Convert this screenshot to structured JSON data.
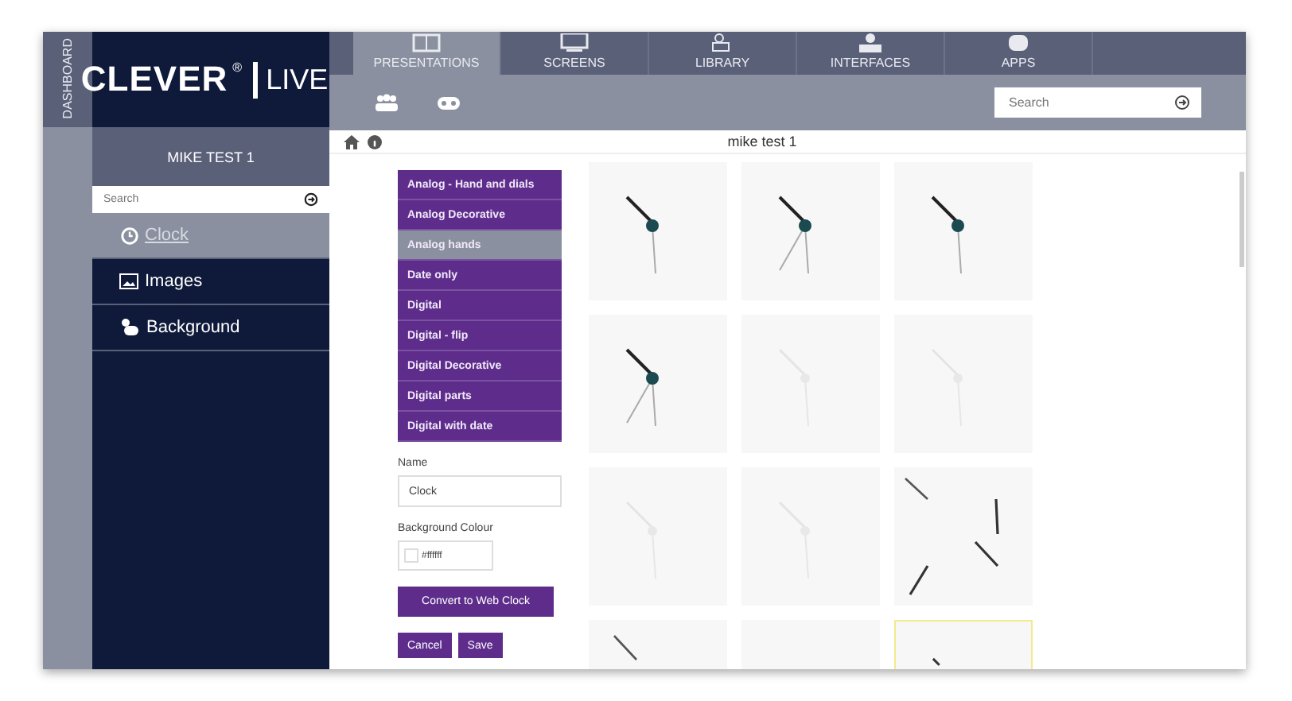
{
  "dashboard_label": "DASHBOARD",
  "logo": {
    "text": "CLEVER",
    "mark": "®",
    "badge": "LIVE"
  },
  "sidebar": {
    "title": "MIKE TEST 1",
    "search": {
      "placeholder": "Search"
    },
    "items": [
      {
        "label": "Clock",
        "selected": true
      },
      {
        "label": "Images",
        "selected": false
      },
      {
        "label": "Background",
        "selected": false
      }
    ]
  },
  "tabs": [
    {
      "label": "PRESENTATIONS",
      "selected": true
    },
    {
      "label": "SCREENS",
      "selected": false
    },
    {
      "label": "LIBRARY",
      "selected": false
    },
    {
      "label": "INTERFACES",
      "selected": false
    },
    {
      "label": "APPS",
      "selected": false
    }
  ],
  "toolbar": {
    "search": {
      "placeholder": "Search"
    }
  },
  "page_title": "mike test 1",
  "categories": [
    {
      "label": "Analog - Hand and dials",
      "selected": false
    },
    {
      "label": "Analog Decorative",
      "selected": false
    },
    {
      "label": "Analog hands",
      "selected": true
    },
    {
      "label": "Date only",
      "selected": false
    },
    {
      "label": "Digital",
      "selected": false
    },
    {
      "label": "Digital - flip",
      "selected": false
    },
    {
      "label": "Digital Decorative",
      "selected": false
    },
    {
      "label": "Digital parts",
      "selected": false
    },
    {
      "label": "Digital with date",
      "selected": false
    }
  ],
  "form": {
    "name_label": "Name",
    "name_value": "Clock",
    "colour_label": "Background Colour",
    "colour_value": "#ffffff",
    "convert_button": "Convert to Web Clock",
    "buttons": [
      "Cancel",
      "Save"
    ]
  },
  "tiles": [
    {
      "kind": "hands",
      "selected": false
    },
    {
      "kind": "hands-second",
      "selected": false
    },
    {
      "kind": "hands",
      "selected": false
    },
    {
      "kind": "hands-second",
      "selected": false
    },
    {
      "kind": "faint",
      "selected": false
    },
    {
      "kind": "faint",
      "selected": false
    },
    {
      "kind": "faint",
      "selected": false
    },
    {
      "kind": "faint",
      "selected": false
    },
    {
      "kind": "ticks",
      "selected": false
    },
    {
      "kind": "line",
      "selected": false
    },
    {
      "kind": "blank",
      "selected": false
    },
    {
      "kind": "mark",
      "selected": true
    }
  ]
}
